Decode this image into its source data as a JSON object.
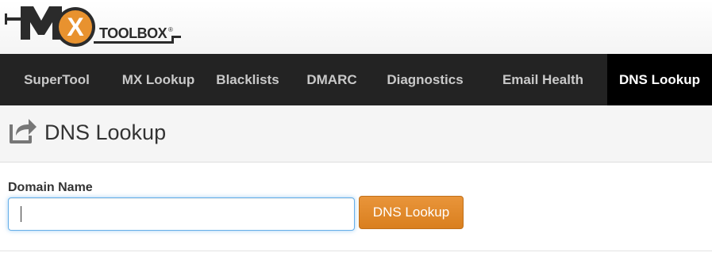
{
  "brand": {
    "logo_letters": "MX",
    "logo_word": "TOOLBOX",
    "registered_mark": "®",
    "accent_color": "#e8922f",
    "dark_color": "#2b2b2b"
  },
  "nav": {
    "items": [
      {
        "label": "SuperTool",
        "active": false
      },
      {
        "label": "MX Lookup",
        "active": false
      },
      {
        "label": "Blacklists",
        "active": false
      },
      {
        "label": "DMARC",
        "active": false
      },
      {
        "label": "Diagnostics",
        "active": false
      },
      {
        "label": "Email Health",
        "active": false
      },
      {
        "label": "DNS Lookup",
        "active": true
      }
    ]
  },
  "page": {
    "title": "DNS Lookup",
    "icon": "share-arrow-icon"
  },
  "form": {
    "field_label": "Domain Name",
    "input_value": "",
    "input_placeholder": "",
    "button_label": "DNS Lookup",
    "button_color": "#e08a2a"
  }
}
